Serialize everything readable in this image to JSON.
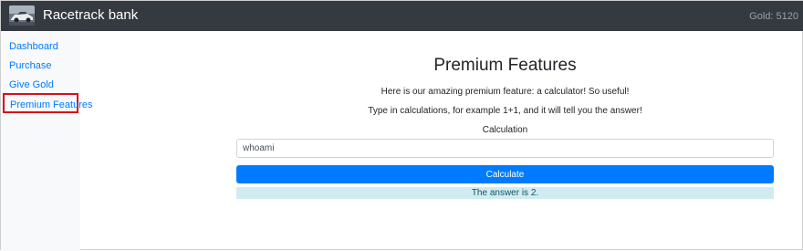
{
  "header": {
    "brand": "Racetrack bank",
    "gold": "Gold: 5120"
  },
  "sidebar": {
    "items": [
      {
        "label": "Dashboard"
      },
      {
        "label": "Purchase"
      },
      {
        "label": "Give Gold"
      },
      {
        "label": "Premium Features",
        "active": true
      }
    ]
  },
  "main": {
    "title": "Premium Features",
    "intro": "Here is our amazing premium feature: a calculator! So useful!",
    "instructions": "Type in calculations, for example 1+1, and it will tell you the answer!",
    "calc_label": "Calculation",
    "input_value": "whoami",
    "button_label": "Calculate",
    "answer": "The answer is 2."
  },
  "colors": {
    "navbar": "#343a40",
    "link": "#007bff",
    "highlight_border": "#d4111a",
    "button": "#007bff",
    "answer_bg": "#d1ecf1",
    "answer_text": "#0c5460"
  },
  "icons": {
    "logo": "race-car-logo"
  }
}
